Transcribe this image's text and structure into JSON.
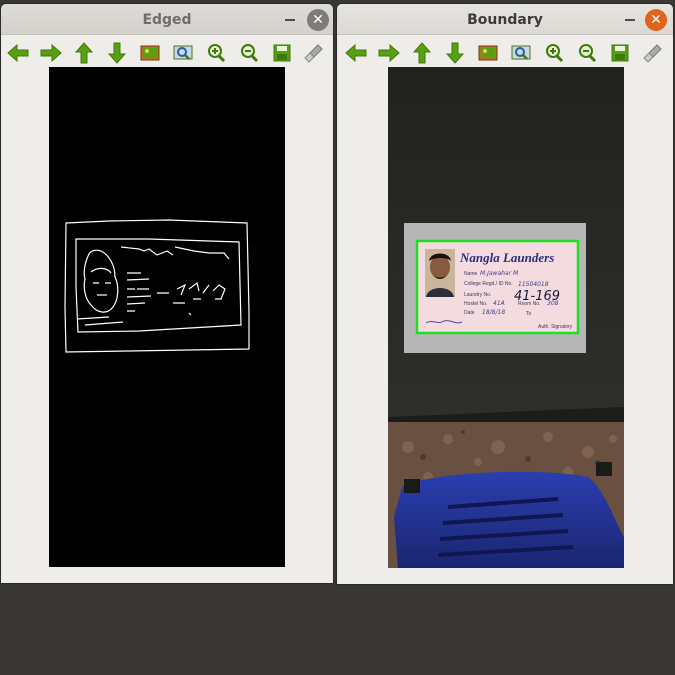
{
  "windows": {
    "edged": {
      "title": "Edged"
    },
    "boundary": {
      "title": "Boundary"
    }
  },
  "toolbar": {
    "items": [
      {
        "icon": "arrow-left-icon"
      },
      {
        "icon": "arrow-right-icon"
      },
      {
        "icon": "arrow-up-icon"
      },
      {
        "icon": "arrow-down-icon"
      },
      {
        "icon": "image-icon"
      },
      {
        "icon": "zoom-fit-icon"
      },
      {
        "icon": "zoom-in-icon"
      },
      {
        "icon": "zoom-out-icon"
      },
      {
        "icon": "save-icon"
      },
      {
        "icon": "properties-icon"
      }
    ]
  },
  "controls": {
    "close_glyph": "✕",
    "minimize_glyph": "_"
  },
  "id_card": {
    "brand": "Nangla Launders",
    "fields": {
      "name_label": "Name",
      "name_value": "M.Jawahar M",
      "college_label": "College Regd./ ID No.",
      "college_value": "11504018",
      "laundry_label": "Laundry No.",
      "laundry_value": "41-169",
      "hostel_label": "Hostel No.",
      "hostel_value": "41A",
      "room_label": "Room No.",
      "room_value": "308",
      "date_label": "Date",
      "date_value": "18/8/18",
      "to_label": "To",
      "signatory": "Auth. Signatory"
    }
  },
  "colors": {
    "toolbar_green": "#5a9e12",
    "close_active": "#e0641e",
    "boundary_box": "#22dd22"
  }
}
